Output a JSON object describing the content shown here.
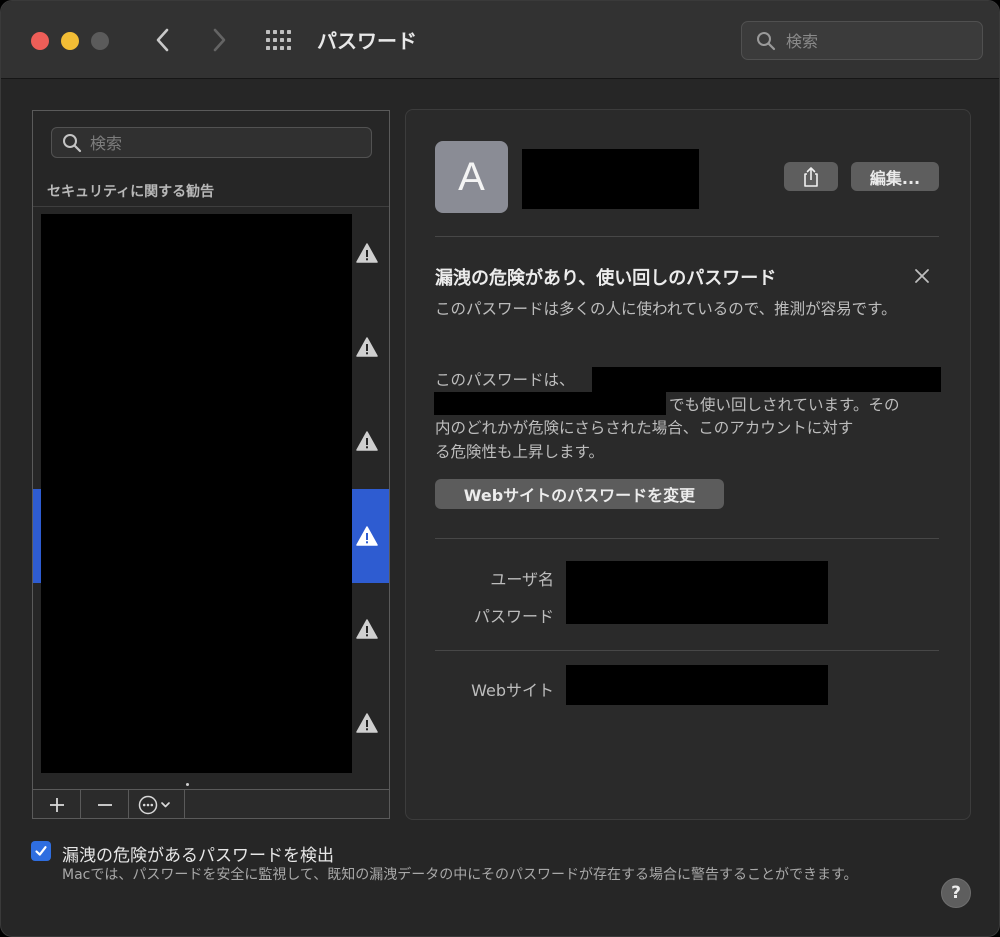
{
  "window": {
    "title": "パスワード"
  },
  "toolbar": {
    "search_placeholder": "検索"
  },
  "sidebar": {
    "search_placeholder": "検索",
    "section_label": "セキュリティに関する勧告",
    "rows": [
      {
        "warning": true,
        "selected": false
      },
      {
        "warning": true,
        "selected": false
      },
      {
        "warning": true,
        "selected": false
      },
      {
        "warning": true,
        "selected": true
      },
      {
        "warning": true,
        "selected": false
      },
      {
        "warning": true,
        "selected": false
      }
    ],
    "bottom_buttons": {
      "add": "+",
      "remove": "−"
    }
  },
  "detail": {
    "avatar_letter": "A",
    "edit_label": "編集...",
    "warning_title": "漏洩の危険があり、使い回しのパスワード",
    "warning_description": "このパスワードは多くの人に使われているので、推測が容易です。",
    "reuse_line_1": "このパスワードは、",
    "reuse_line_2": "でも使い回しされています。その",
    "reuse_line_3": "内のどれかが危険にさらされた場合、このアカウントに対す",
    "reuse_line_4": "る危険性も上昇します。",
    "change_password_button": "Webサイトのパスワードを変更",
    "username_label": "ユーザ名",
    "password_label": "パスワード",
    "website_label": "Webサイト"
  },
  "footer": {
    "checkbox_checked": true,
    "checkbox_label": "漏洩の危険があるパスワードを検出",
    "description": "Macでは、パスワードを安全に監視して、既知の漏洩データの中にそのパスワードが存在する場合に警告することができます。",
    "help_label": "?"
  },
  "colors": {
    "accent": "#2e5cd1",
    "checkbox": "#2f6ee0",
    "traffic_red": "#ee5e58",
    "traffic_yellow": "#f2bd35"
  }
}
